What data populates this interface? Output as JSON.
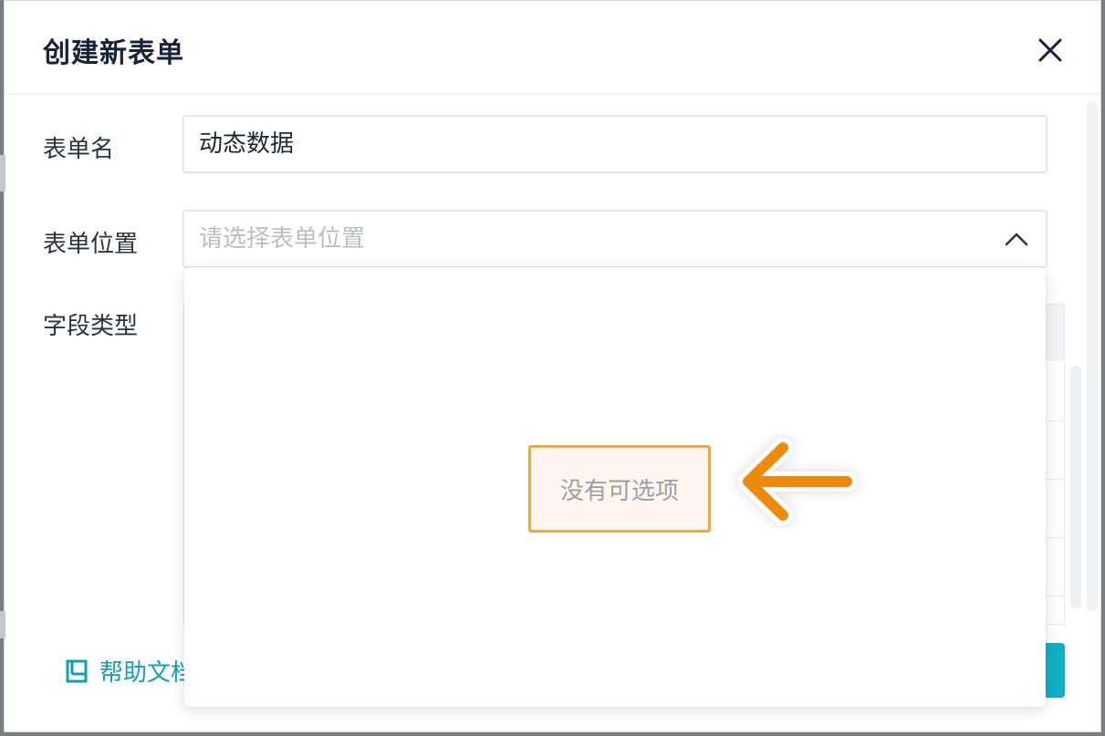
{
  "dialog": {
    "title": "创建新表单",
    "close_icon": "close-icon"
  },
  "form": {
    "name_label": "表单名",
    "name_value": "动态数据",
    "location_label": "表单位置",
    "location_placeholder": "请选择表单位置",
    "field_type_label": "字段类型"
  },
  "dropdown": {
    "empty_text": "没有可选项"
  },
  "footer": {
    "help_label": "帮助文档",
    "help_icon": "book-icon"
  },
  "colors": {
    "accent": "#12a0b3",
    "highlight_border": "#f0a843",
    "arrow": "#ee8a0b"
  }
}
